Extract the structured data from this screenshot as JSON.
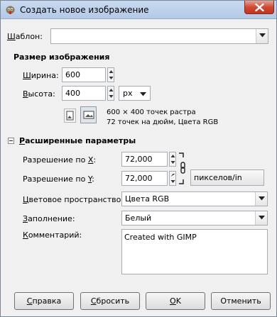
{
  "window": {
    "title": "Создать новое изображение",
    "app_icon": "gimp-icon",
    "close_icon": "close-icon"
  },
  "template": {
    "label": "Шаблон:",
    "label_mnemonic": "Ш",
    "label_rest": "аблон:",
    "value": ""
  },
  "image_size": {
    "heading": "Размер изображения",
    "width_label_m": "Ш",
    "width_label_rest": "ирина:",
    "width_value": "600",
    "height_label_m": "В",
    "height_label_rest": "ысота:",
    "height_value": "400",
    "unit": "px",
    "info_line1": "600 × 400 точек растра",
    "info_line2": "72 точек на дюйм, Цвета RGB",
    "portrait_icon": "portrait-icon",
    "landscape_icon": "landscape-icon"
  },
  "advanced": {
    "heading_m": "Р",
    "heading_rest": "асширенные параметры",
    "expanded": true,
    "xres_label_pre": "Разрешение по ",
    "xres_label_m": "X",
    "xres_label_post": ":",
    "xres_value": "72,000",
    "yres_label_pre": "Разрешение по ",
    "yres_label_m": "Y",
    "yres_label_post": ":",
    "yres_value": "72,000",
    "res_unit": "пикселов/in",
    "chain_icon": "chain-link-icon",
    "colorspace_label_m": "Ц",
    "colorspace_label_rest": "ветовое пространство:",
    "colorspace_value": "Цвета RGB",
    "fill_label_m": "З",
    "fill_label_rest": "аполнение:",
    "fill_value": "Белый",
    "comment_label_m": "К",
    "comment_label_rest": "омментарий:",
    "comment_value": "Created with GIMP"
  },
  "buttons": {
    "help": "Справка",
    "help_m": "С",
    "help_rest": "правка",
    "reset_m": "С",
    "reset_pre": "",
    "reset_rest": "бросить",
    "ok_m": "O",
    "ok_rest": "K",
    "cancel": "Отменить"
  },
  "colors": {
    "titlebar": "#bcd0ea",
    "close": "#c84530",
    "border": "#a5acb5"
  }
}
